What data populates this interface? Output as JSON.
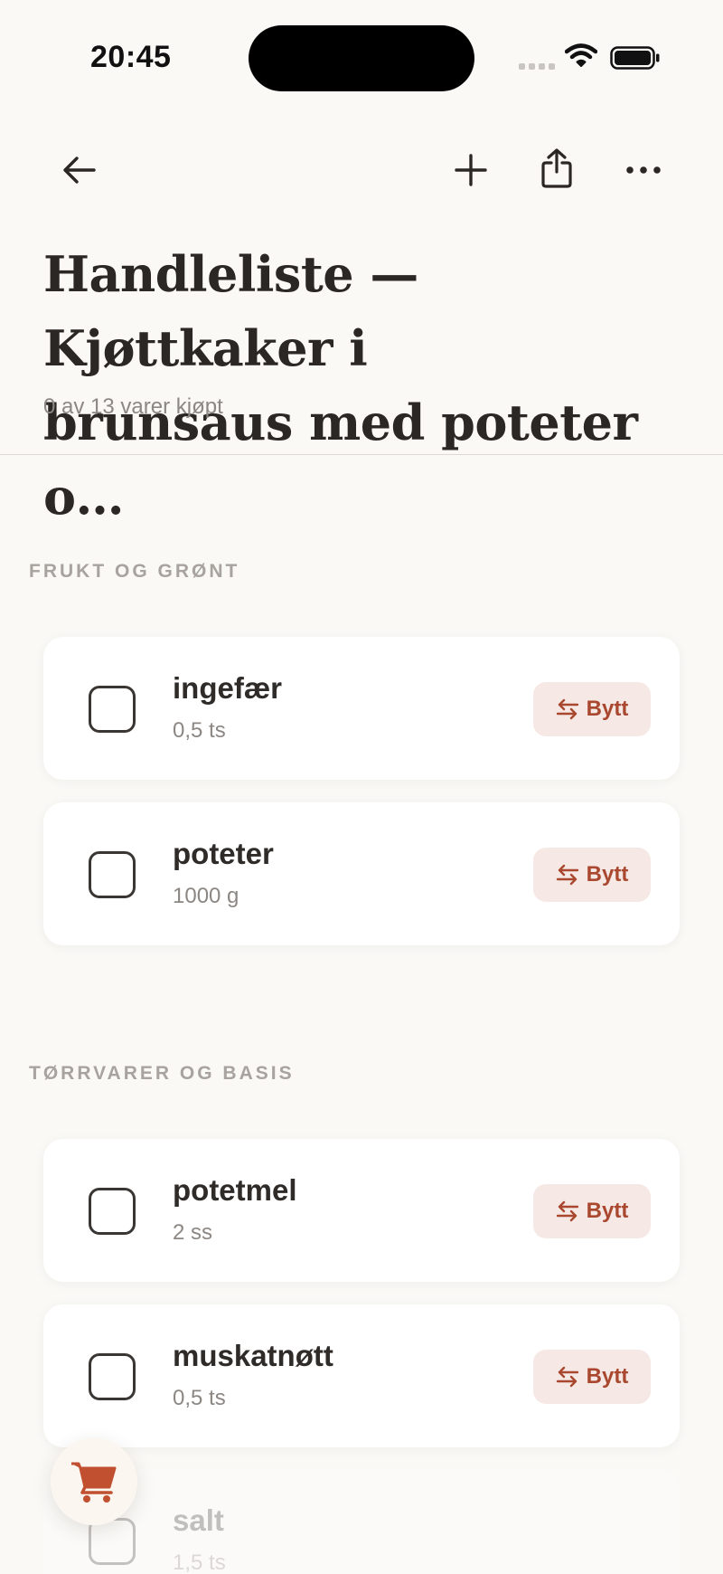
{
  "status_bar": {
    "time": "20:45",
    "signal_icon": "cellular-signal-icon",
    "wifi_icon": "wifi-icon",
    "battery_icon": "battery-icon"
  },
  "toolbar": {
    "back_icon": "arrow-left-icon",
    "add_icon": "plus-icon",
    "share_icon": "share-icon",
    "more_icon": "ellipsis-icon"
  },
  "header": {
    "title_line1": "Handleliste — Kjøttkaker i",
    "title_line2": "brunsaus med poteter o…",
    "progress_text": "0 av 13 varer kjøpt"
  },
  "sections": [
    {
      "title": "FRUKT OG GRØNT",
      "items": [
        {
          "name": "ingefær",
          "qty": "0,5 ts",
          "checked": false,
          "swap_label": "Bytt"
        },
        {
          "name": "poteter",
          "qty": "1000 g",
          "checked": false,
          "swap_label": "Bytt"
        }
      ]
    },
    {
      "title": "TØRRVARER OG BASIS",
      "items": [
        {
          "name": "potetmel",
          "qty": "2 ss",
          "checked": false,
          "swap_label": "Bytt"
        },
        {
          "name": "muskatnøtt",
          "qty": "0,5 ts",
          "checked": false,
          "swap_label": "Bytt"
        },
        {
          "name": "salt",
          "qty": "1,5 ts",
          "checked": false,
          "swap_label": ""
        }
      ]
    }
  ],
  "fab": {
    "icon": "shopping-cart-icon"
  },
  "colors": {
    "background": "#FAF9F6",
    "accent": "#A9472F",
    "accent_bg": "#F6E9E5",
    "text": "#2B2724",
    "muted": "#8C8782"
  }
}
